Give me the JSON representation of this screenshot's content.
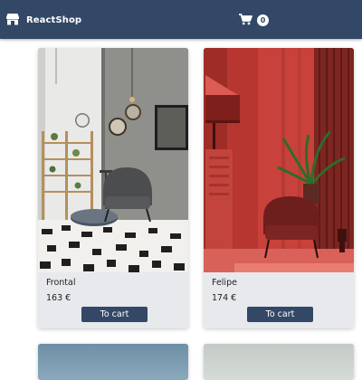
{
  "navbar": {
    "brand_icon": "store-icon",
    "brand_label": "ReactShop",
    "cart_icon": "shopping-cart-icon",
    "cart_count": "0",
    "background_color": "#324866"
  },
  "products": [
    {
      "name": "Frontal",
      "price": "163 €",
      "button_label": "To cart",
      "image": "interior-armchair-photo"
    },
    {
      "name": "Felipe",
      "price": "174 €",
      "button_label": "To cart",
      "image": "red-room-armchair-photo"
    }
  ]
}
